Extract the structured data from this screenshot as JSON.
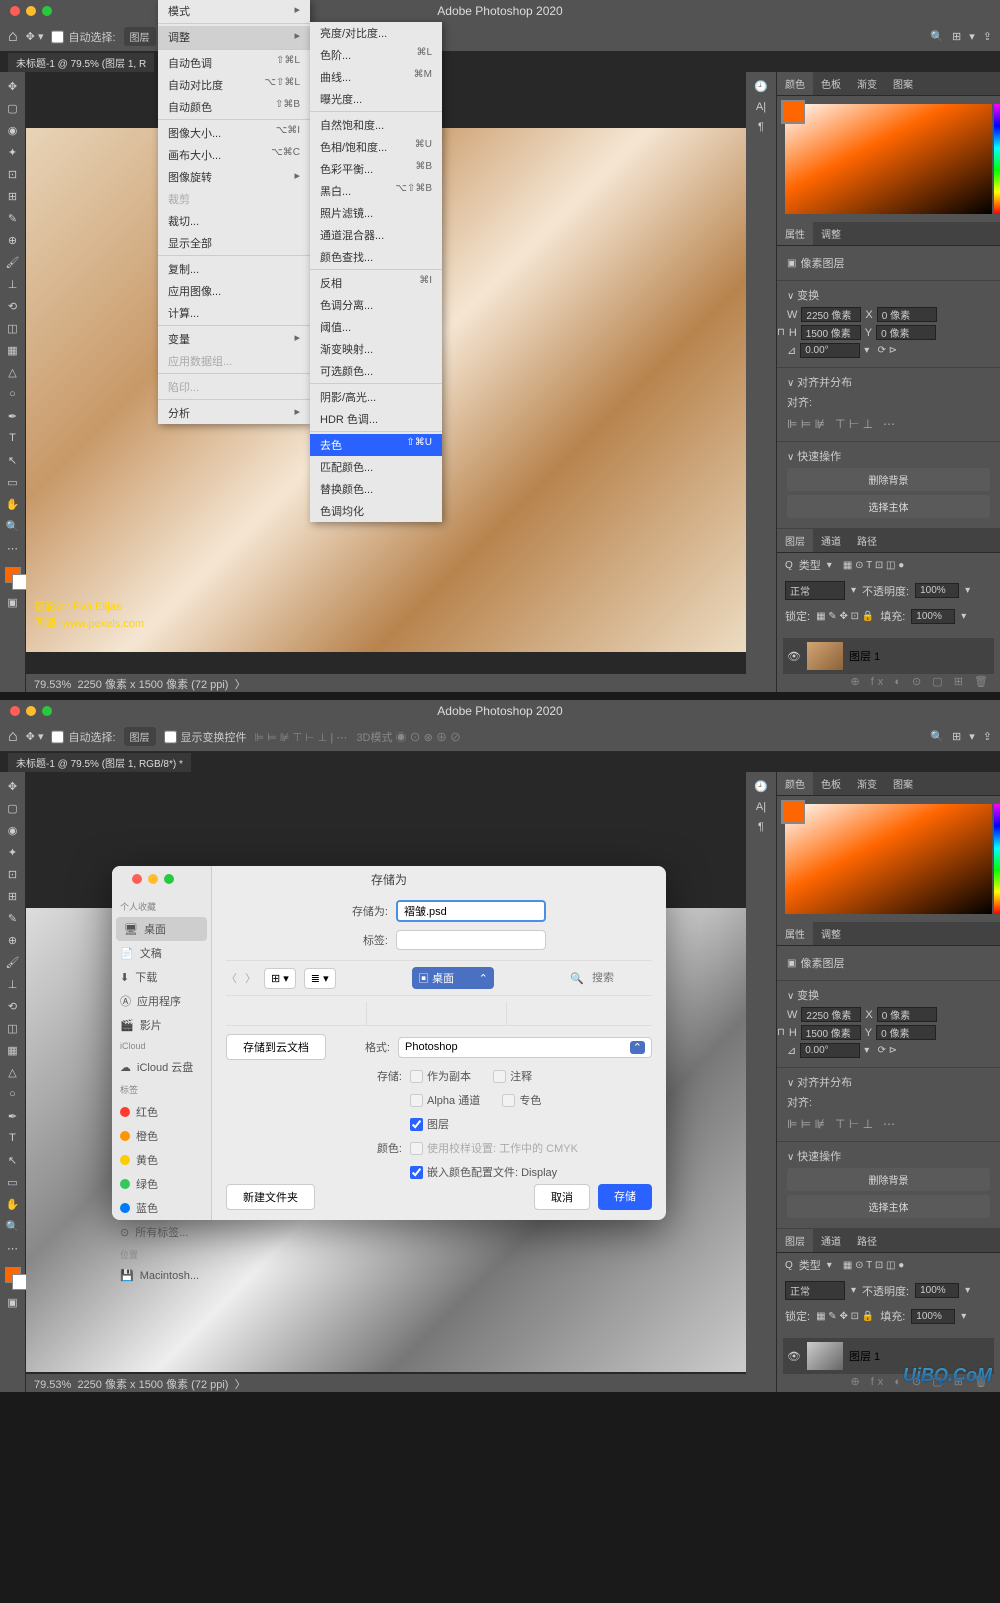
{
  "app1": {
    "title": "Adobe Photoshop 2020",
    "tab": "未标题-1 @ 79.5% (图层 1, R",
    "autoSelect": "自动选择:",
    "autoSelectVal": "图层",
    "credit1": "摄影师:   Eva Elijas",
    "credit2": "图源:   www.pexels.com",
    "zoom": "79.53%",
    "dims": "2250 像素 x 1500 像素 (72 ppi)",
    "menu1": {
      "mode": "模式",
      "adjust": "调整",
      "autoTone": "自动色调",
      "autoToneSC": "⇧⌘L",
      "autoContrast": "自动对比度",
      "autoContrastSC": "⌥⇧⌘L",
      "autoColor": "自动颜色",
      "autoColorSC": "⇧⌘B",
      "imageSize": "图像大小...",
      "imageSizeSC": "⌥⌘I",
      "canvasSize": "画布大小...",
      "canvasSizeSC": "⌥⌘C",
      "imageRotation": "图像旋转",
      "crop": "裁剪",
      "trim": "裁切...",
      "revealAll": "显示全部",
      "duplicate": "复制...",
      "applyImage": "应用图像...",
      "calculations": "计算...",
      "variables": "变量",
      "applyDataSet": "应用数据组...",
      "trap": "陷印...",
      "analysis": "分析"
    },
    "menu2": {
      "brightness": "亮度/对比度...",
      "levels": "色阶...",
      "levelsSC": "⌘L",
      "curves": "曲线...",
      "curvesSC": "⌘M",
      "exposure": "曝光度...",
      "vibrance": "自然饱和度...",
      "hue": "色相/饱和度...",
      "hueSC": "⌘U",
      "colorBalance": "色彩平衡...",
      "colorBalanceSC": "⌘B",
      "blackWhite": "黑白...",
      "blackWhiteSC": "⌥⇧⌘B",
      "photoFilter": "照片滤镜...",
      "channelMixer": "通道混合器...",
      "colorLookup": "颜色查找...",
      "invert": "反相",
      "invertSC": "⌘I",
      "posterize": "色调分离...",
      "threshold": "阈值...",
      "gradientMap": "渐变映射...",
      "selectiveColor": "可选颜色...",
      "shadows": "阴影/高光...",
      "hdr": "HDR 色调...",
      "desaturate": "去色",
      "desaturateSC": "⇧⌘U",
      "matchColor": "匹配颜色...",
      "replaceColor": "替换颜色...",
      "equalize": "色调均化"
    }
  },
  "panels": {
    "color": "颜色",
    "swatches": "色板",
    "gradients": "渐变",
    "patterns": "图案",
    "properties": "属性",
    "adjust": "调整",
    "pixelLayer": "像素图层",
    "transform": "变换",
    "w": "W",
    "wVal": "2250 像素",
    "x": "X",
    "xVal": "0 像素",
    "h": "H",
    "hVal": "1500 像素",
    "y": "Y",
    "yVal": "0 像素",
    "angle": "⊿",
    "angleVal": "0.00°",
    "alignDistribute": "对齐并分布",
    "align": "对齐:",
    "quickActions": "快速操作",
    "removeBg": "删除背景",
    "selectSubject": "选择主体",
    "layers": "图层",
    "channels": "通道",
    "paths": "路径",
    "kind": "类型",
    "normal": "正常",
    "opacity": "不透明度:",
    "opacityVal": "100%",
    "lock": "锁定:",
    "fill": "填充:",
    "fillVal": "100%",
    "layer1": "图层 1"
  },
  "app2": {
    "title": "Adobe Photoshop 2020",
    "tab": "未标题-1 @ 79.5% (图层 1, RGB/8*) *",
    "showTransform": "显示变换控件",
    "zoom": "79.53%",
    "dims": "2250 像素 x 1500 像素 (72 ppi)",
    "dialog": {
      "title": "存储为",
      "favorites": "个人收藏",
      "desktop": "桌面",
      "documents": "文稿",
      "downloads": "下载",
      "apps": "应用程序",
      "movies": "影片",
      "icloud": "iCloud",
      "icloudDrive": "iCloud 云盘",
      "tags": "标签",
      "red": "红色",
      "orange": "橙色",
      "yellow": "黄色",
      "green": "绿色",
      "blue": "蓝色",
      "allTags": "所有标签...",
      "locations": "位置",
      "macintosh": "Macintosh...",
      "saveAs": "存储为:",
      "filename": "褶皱.psd",
      "tagLabel": "标签:",
      "locationLabel": "桌面",
      "search": "搜索",
      "saveToCloud": "存储到云文档",
      "newFolder": "新建文件夹",
      "format": "格式:",
      "formatVal": "Photoshop",
      "save": "存储:",
      "asCopy": "作为副本",
      "notes": "注释",
      "alpha": "Alpha 通道",
      "spot": "专色",
      "layersChk": "图层",
      "colorLabel": "颜色:",
      "cmyk": "使用校样设置: 工作中的 CMYK",
      "embed": "嵌入颜色配置文件: Display",
      "cancel": "取消",
      "saveBtn": "存储"
    }
  },
  "watermark": "UiBQ.CoM"
}
